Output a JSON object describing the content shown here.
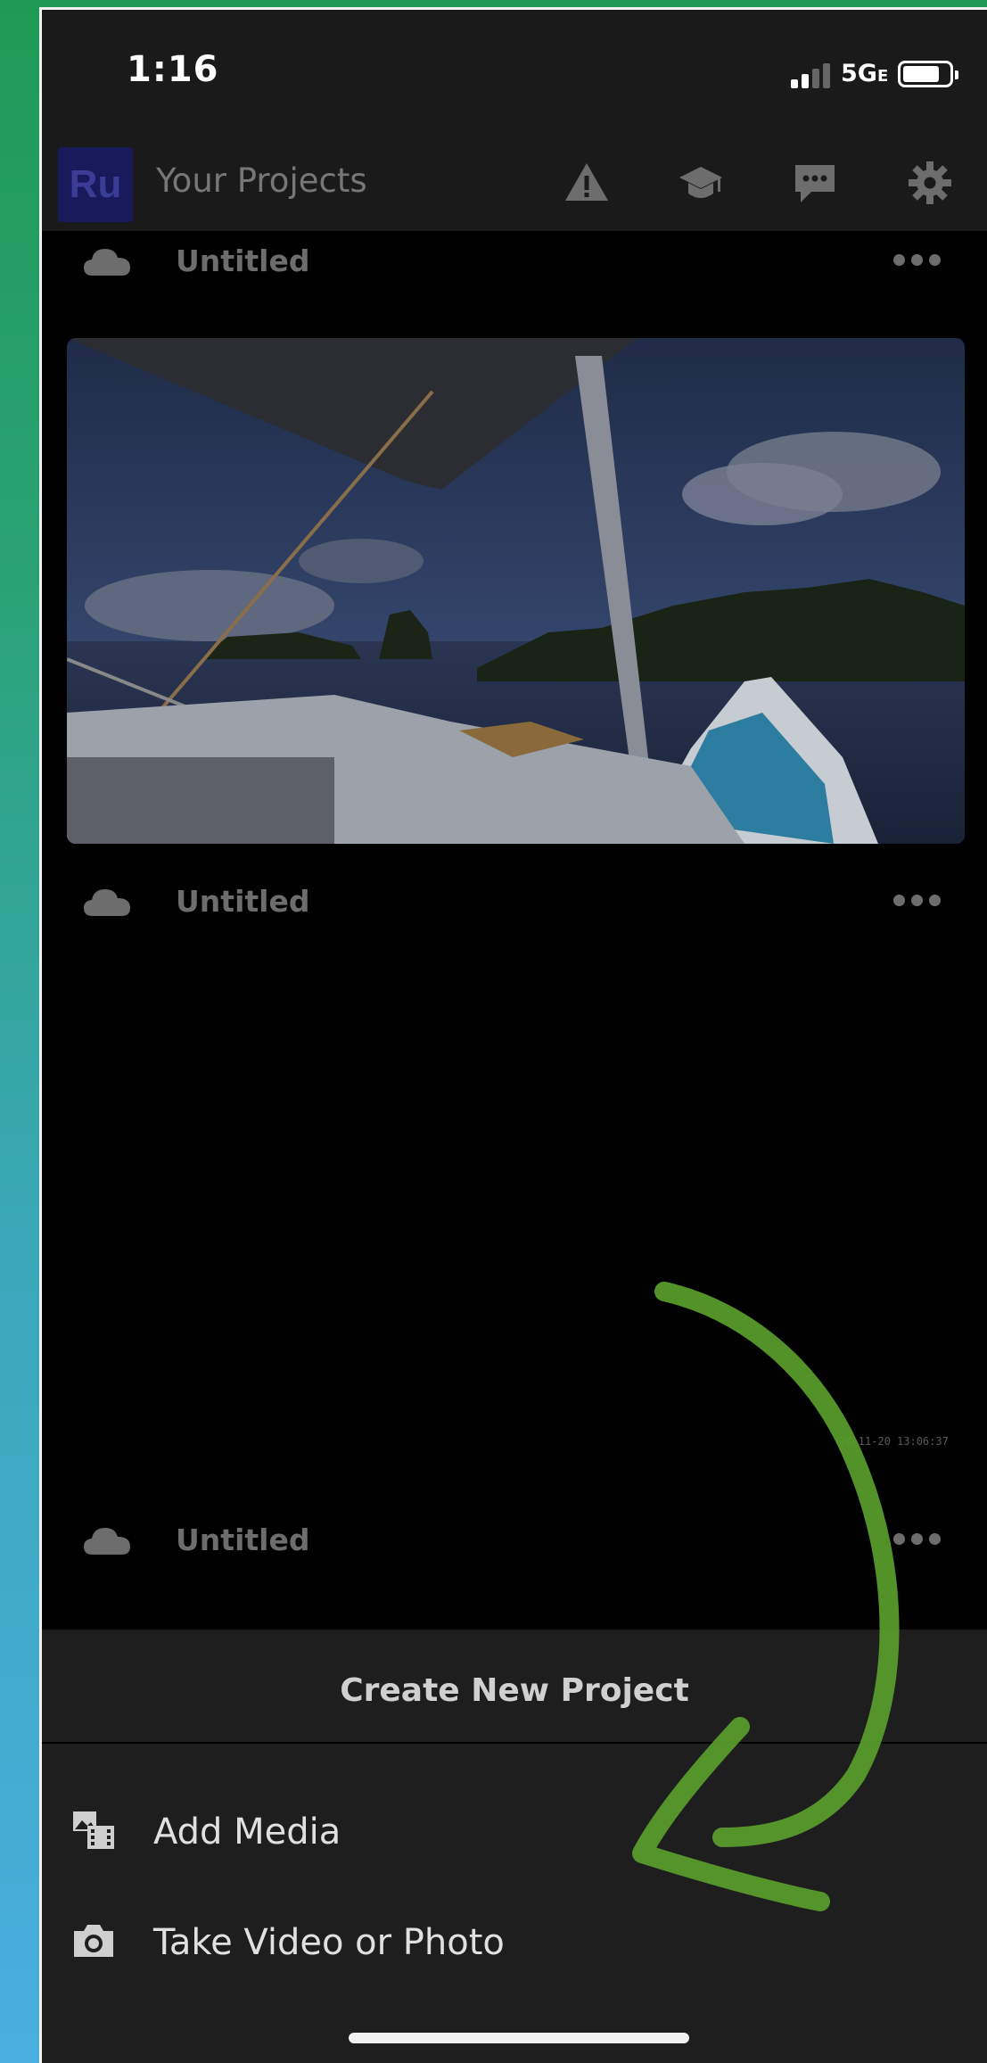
{
  "status_bar": {
    "time": "1:16",
    "network": "5G",
    "network_suffix": "E"
  },
  "header": {
    "logo_text": "Ru",
    "title": "Your Projects"
  },
  "header_icons": [
    "warning-icon",
    "learn-icon",
    "feedback-icon",
    "gear-icon"
  ],
  "projects": [
    {
      "name": "Untitled"
    },
    {
      "name": "Untitled"
    },
    {
      "name": "Untitled"
    }
  ],
  "third_project_timestamp": "20-11-20 13:06:37",
  "sheet": {
    "title": "Create New Project",
    "items": [
      {
        "label": "Add Media",
        "icon": "add-media-icon"
      },
      {
        "label": "Take Video or Photo",
        "icon": "camera-icon"
      }
    ]
  },
  "colors": {
    "annotation_arrow": "#5a9e2c",
    "sheet_bg": "#1e1e1e",
    "header_bg": "#1a1a1a"
  }
}
